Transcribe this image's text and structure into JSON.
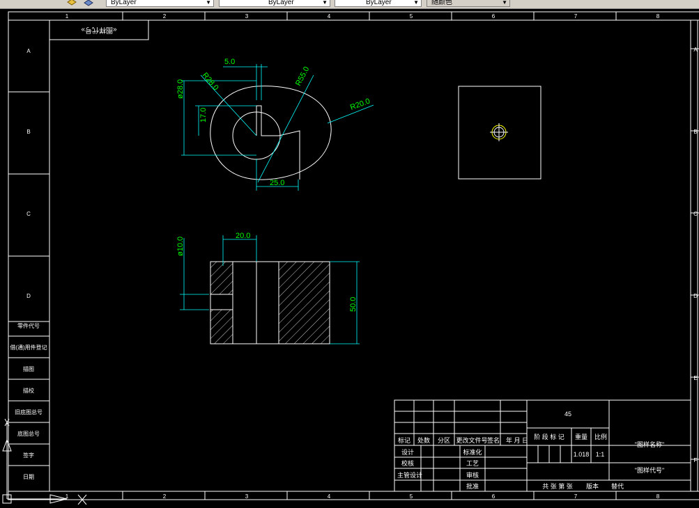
{
  "toolbar": {
    "combo1_value": "ByLayer",
    "combo2_value": "ByLayer",
    "combo3_value": "ByLayer",
    "combo4_value": "随颜色"
  },
  "frame": {
    "col_labels": [
      "1",
      "2",
      "3",
      "4",
      "5",
      "6",
      "7",
      "8"
    ],
    "row_labels": [
      "A",
      "B",
      "C",
      "D",
      "E",
      "F"
    ]
  },
  "corner_label": "«图样代号»",
  "dimensions": {
    "d5": "5.0",
    "r28": "R28.0",
    "r55": "R55.0",
    "dia28": "ø28.0",
    "d17": "17.0",
    "r20": "R20.0",
    "d25": "25.0",
    "d20": "20.0",
    "dia10": "ø10.0",
    "d50": "50.0"
  },
  "left_table": [
    "零件代号",
    "借(通)用件登记",
    "描图",
    "描校",
    "旧底图总号",
    "底图总号",
    "签字",
    "日期"
  ],
  "title_block": {
    "hdr_mark": "标记",
    "hdr_count": "处数",
    "hdr_zone": "分区",
    "hdr_doc": "更改文件号",
    "hdr_sign": "签名",
    "hdr_date": "年 月 日",
    "design": "设计",
    "standard": "标准化",
    "check": "校核",
    "process": "工艺",
    "chief": "主管设计",
    "review": "审核",
    "approve": "批准",
    "material": "45",
    "stage": "阶 段 标 记",
    "weight_label": "重量",
    "scale_label": "比例",
    "weight": "1.018",
    "scale": "1:1",
    "drawing_name": "\"图样名称\"",
    "drawing_code": "\"图样代号\"",
    "sheets": "共  张  第  张",
    "version": "版本",
    "replace": "替代"
  }
}
